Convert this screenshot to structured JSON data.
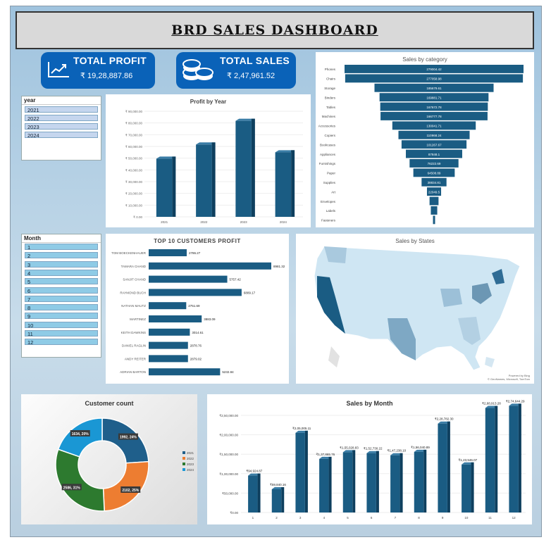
{
  "header": {
    "title": "BRD SALES DASHBOARD"
  },
  "kpis": {
    "profit": {
      "title": "TOTAL PROFIT",
      "value": "₹ 19,28,887.86",
      "icon": "trend-chart-icon"
    },
    "sales": {
      "title": "TOTAL SALES",
      "value": "₹ 2,47,961.52",
      "icon": "coins-icon"
    }
  },
  "year_slicer": {
    "title": "year",
    "items": [
      "2021",
      "2022",
      "2023",
      "2024"
    ]
  },
  "month_slicer": {
    "title": "Month",
    "items": [
      "1",
      "2",
      "3",
      "4",
      "5",
      "6",
      "7",
      "8",
      "9",
      "10",
      "11",
      "12"
    ]
  },
  "map": {
    "title": "Sales by States",
    "credit_1": "Powered by Bing",
    "credit_2": "© GeoNames, Microsoft, TomTom"
  },
  "colors": {
    "bar": "#1a5c83",
    "kpi": "#0a62b8",
    "donut": [
      "#1f5f8b",
      "#ed7d31",
      "#2d7a2f",
      "#1a97d4"
    ]
  },
  "chart_data": [
    {
      "id": "profit_by_year",
      "type": "bar",
      "title": "Profit by Year",
      "categories": [
        "2021",
        "2022",
        "2023",
        "2024"
      ],
      "values": [
        49543.97,
        61618.6,
        81795.17,
        55000
      ],
      "y_ticks": [
        "₹ 0.00",
        "₹ 10,000.00",
        "₹ 20,000.00",
        "₹ 30,000.00",
        "₹ 40,000.00",
        "₹ 50,000.00",
        "₹ 60,000.00",
        "₹ 70,000.00",
        "₹ 80,000.00",
        "₹ 90,000.00"
      ],
      "ylim": [
        0,
        90000
      ]
    },
    {
      "id": "sales_by_category",
      "type": "bar",
      "orientation": "funnel",
      "title": "Sales by category",
      "categories": [
        "Phones",
        "Chairs",
        "Storage",
        "Binders",
        "Tables",
        "Machines",
        "Accessories",
        "Copiers",
        "Bookcases",
        "Appliances",
        "Furnishings",
        "Paper",
        "Supplies",
        "Art",
        "Envelopes",
        "Labels",
        "Fasteners"
      ],
      "values": [
        279004.42,
        277058.98,
        185679.61,
        169881.71,
        167672.78,
        166777.78,
        130041.71,
        110968.24,
        101267.67,
        87848.1,
        76222.69,
        64508.89,
        38834.81,
        22049.5,
        14000,
        10000,
        2800
      ],
      "labels": [
        "279004.42",
        "277058.98",
        "185679.61",
        "169881.71",
        "167672.78",
        "166777.78",
        "130041.71",
        "110968.24",
        "101267.67",
        "87848.1",
        "76222.69",
        "64508.89",
        "38834.81",
        "22049.5",
        "",
        "",
        ""
      ]
    },
    {
      "id": "top10_customers_profit",
      "type": "bar",
      "orientation": "horizontal",
      "title": "TOP 10 CUSTOMERS PROFIT",
      "categories": [
        "TOM BOECKENHAUER",
        "TAMARA CHAND",
        "SANJIT CHAND",
        "RAYMOND BUCH",
        "NATHAN MAUTZ",
        "MARTINEZ",
        "KEITH DAWKINS",
        "DANIEL RAGLIN",
        "ANDY REITER",
        "ADRIAN BARTON"
      ],
      "values": [
        2786.27,
        8981.32,
        5757.42,
        6809.17,
        2751.69,
        3883.09,
        3014.61,
        2878.76,
        2879.02,
        5232.84
      ],
      "labels": [
        "2786.27",
        "8981.32",
        "5757.42",
        "6809.17",
        "2751.69",
        "3883.09",
        "3014.61",
        "2878.76",
        "2879.02",
        "5232.84"
      ]
    },
    {
      "id": "customer_count",
      "type": "pie",
      "title": "Customer count",
      "categories": [
        "2021",
        "2022",
        "2023",
        "2024"
      ],
      "values": [
        1992,
        2102,
        2586,
        1634
      ],
      "labels": [
        "1992, 24%",
        "2102, 25%",
        "2586, 31%",
        "1634, 20%"
      ]
    },
    {
      "id": "sales_by_month",
      "type": "bar",
      "title": "Sales by Month",
      "categories": [
        "1",
        "2",
        "3",
        "4",
        "5",
        "6",
        "7",
        "8",
        "9",
        "10",
        "11",
        "12"
      ],
      "values": [
        94924.87,
        59840.16,
        205005.11,
        137865.76,
        155028.83,
        152730.22,
        147238.1,
        156040.89,
        228782.3,
        123546.07,
        268913.28,
        274644.29
      ],
      "labels": [
        "₹94,924.87",
        "₹59,840.16",
        "₹2,05,005.11",
        "₹1,37,865.76",
        "₹1,55,028.83",
        "₹1,52,730.22",
        "₹1,47,238.10",
        "₹1,56,040.89",
        "₹2,28,782.30",
        "₹1,23,546.07",
        "₹2,68,913.28",
        "₹2,74,644.29"
      ],
      "y_ticks": [
        "₹0.00",
        "₹50,000.00",
        "₹1,00,000.00",
        "₹1,50,000.00",
        "₹2,00,000.00",
        "₹2,50,000.00"
      ],
      "ylim": [
        0,
        250000
      ]
    }
  ]
}
